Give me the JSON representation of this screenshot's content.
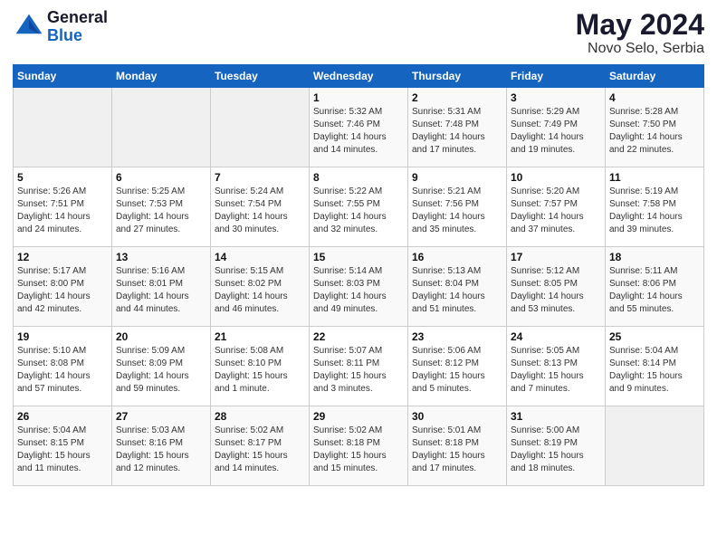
{
  "header": {
    "logo_general": "General",
    "logo_blue": "Blue",
    "main_title": "May 2024",
    "sub_title": "Novo Selo, Serbia"
  },
  "weekdays": [
    "Sunday",
    "Monday",
    "Tuesday",
    "Wednesday",
    "Thursday",
    "Friday",
    "Saturday"
  ],
  "weeks": [
    [
      {
        "day": "",
        "info": ""
      },
      {
        "day": "",
        "info": ""
      },
      {
        "day": "",
        "info": ""
      },
      {
        "day": "1",
        "info": "Sunrise: 5:32 AM\nSunset: 7:46 PM\nDaylight: 14 hours\nand 14 minutes."
      },
      {
        "day": "2",
        "info": "Sunrise: 5:31 AM\nSunset: 7:48 PM\nDaylight: 14 hours\nand 17 minutes."
      },
      {
        "day": "3",
        "info": "Sunrise: 5:29 AM\nSunset: 7:49 PM\nDaylight: 14 hours\nand 19 minutes."
      },
      {
        "day": "4",
        "info": "Sunrise: 5:28 AM\nSunset: 7:50 PM\nDaylight: 14 hours\nand 22 minutes."
      }
    ],
    [
      {
        "day": "5",
        "info": "Sunrise: 5:26 AM\nSunset: 7:51 PM\nDaylight: 14 hours\nand 24 minutes."
      },
      {
        "day": "6",
        "info": "Sunrise: 5:25 AM\nSunset: 7:53 PM\nDaylight: 14 hours\nand 27 minutes."
      },
      {
        "day": "7",
        "info": "Sunrise: 5:24 AM\nSunset: 7:54 PM\nDaylight: 14 hours\nand 30 minutes."
      },
      {
        "day": "8",
        "info": "Sunrise: 5:22 AM\nSunset: 7:55 PM\nDaylight: 14 hours\nand 32 minutes."
      },
      {
        "day": "9",
        "info": "Sunrise: 5:21 AM\nSunset: 7:56 PM\nDaylight: 14 hours\nand 35 minutes."
      },
      {
        "day": "10",
        "info": "Sunrise: 5:20 AM\nSunset: 7:57 PM\nDaylight: 14 hours\nand 37 minutes."
      },
      {
        "day": "11",
        "info": "Sunrise: 5:19 AM\nSunset: 7:58 PM\nDaylight: 14 hours\nand 39 minutes."
      }
    ],
    [
      {
        "day": "12",
        "info": "Sunrise: 5:17 AM\nSunset: 8:00 PM\nDaylight: 14 hours\nand 42 minutes."
      },
      {
        "day": "13",
        "info": "Sunrise: 5:16 AM\nSunset: 8:01 PM\nDaylight: 14 hours\nand 44 minutes."
      },
      {
        "day": "14",
        "info": "Sunrise: 5:15 AM\nSunset: 8:02 PM\nDaylight: 14 hours\nand 46 minutes."
      },
      {
        "day": "15",
        "info": "Sunrise: 5:14 AM\nSunset: 8:03 PM\nDaylight: 14 hours\nand 49 minutes."
      },
      {
        "day": "16",
        "info": "Sunrise: 5:13 AM\nSunset: 8:04 PM\nDaylight: 14 hours\nand 51 minutes."
      },
      {
        "day": "17",
        "info": "Sunrise: 5:12 AM\nSunset: 8:05 PM\nDaylight: 14 hours\nand 53 minutes."
      },
      {
        "day": "18",
        "info": "Sunrise: 5:11 AM\nSunset: 8:06 PM\nDaylight: 14 hours\nand 55 minutes."
      }
    ],
    [
      {
        "day": "19",
        "info": "Sunrise: 5:10 AM\nSunset: 8:08 PM\nDaylight: 14 hours\nand 57 minutes."
      },
      {
        "day": "20",
        "info": "Sunrise: 5:09 AM\nSunset: 8:09 PM\nDaylight: 14 hours\nand 59 minutes."
      },
      {
        "day": "21",
        "info": "Sunrise: 5:08 AM\nSunset: 8:10 PM\nDaylight: 15 hours\nand 1 minute."
      },
      {
        "day": "22",
        "info": "Sunrise: 5:07 AM\nSunset: 8:11 PM\nDaylight: 15 hours\nand 3 minutes."
      },
      {
        "day": "23",
        "info": "Sunrise: 5:06 AM\nSunset: 8:12 PM\nDaylight: 15 hours\nand 5 minutes."
      },
      {
        "day": "24",
        "info": "Sunrise: 5:05 AM\nSunset: 8:13 PM\nDaylight: 15 hours\nand 7 minutes."
      },
      {
        "day": "25",
        "info": "Sunrise: 5:04 AM\nSunset: 8:14 PM\nDaylight: 15 hours\nand 9 minutes."
      }
    ],
    [
      {
        "day": "26",
        "info": "Sunrise: 5:04 AM\nSunset: 8:15 PM\nDaylight: 15 hours\nand 11 minutes."
      },
      {
        "day": "27",
        "info": "Sunrise: 5:03 AM\nSunset: 8:16 PM\nDaylight: 15 hours\nand 12 minutes."
      },
      {
        "day": "28",
        "info": "Sunrise: 5:02 AM\nSunset: 8:17 PM\nDaylight: 15 hours\nand 14 minutes."
      },
      {
        "day": "29",
        "info": "Sunrise: 5:02 AM\nSunset: 8:18 PM\nDaylight: 15 hours\nand 15 minutes."
      },
      {
        "day": "30",
        "info": "Sunrise: 5:01 AM\nSunset: 8:18 PM\nDaylight: 15 hours\nand 17 minutes."
      },
      {
        "day": "31",
        "info": "Sunrise: 5:00 AM\nSunset: 8:19 PM\nDaylight: 15 hours\nand 18 minutes."
      },
      {
        "day": "",
        "info": ""
      }
    ]
  ]
}
